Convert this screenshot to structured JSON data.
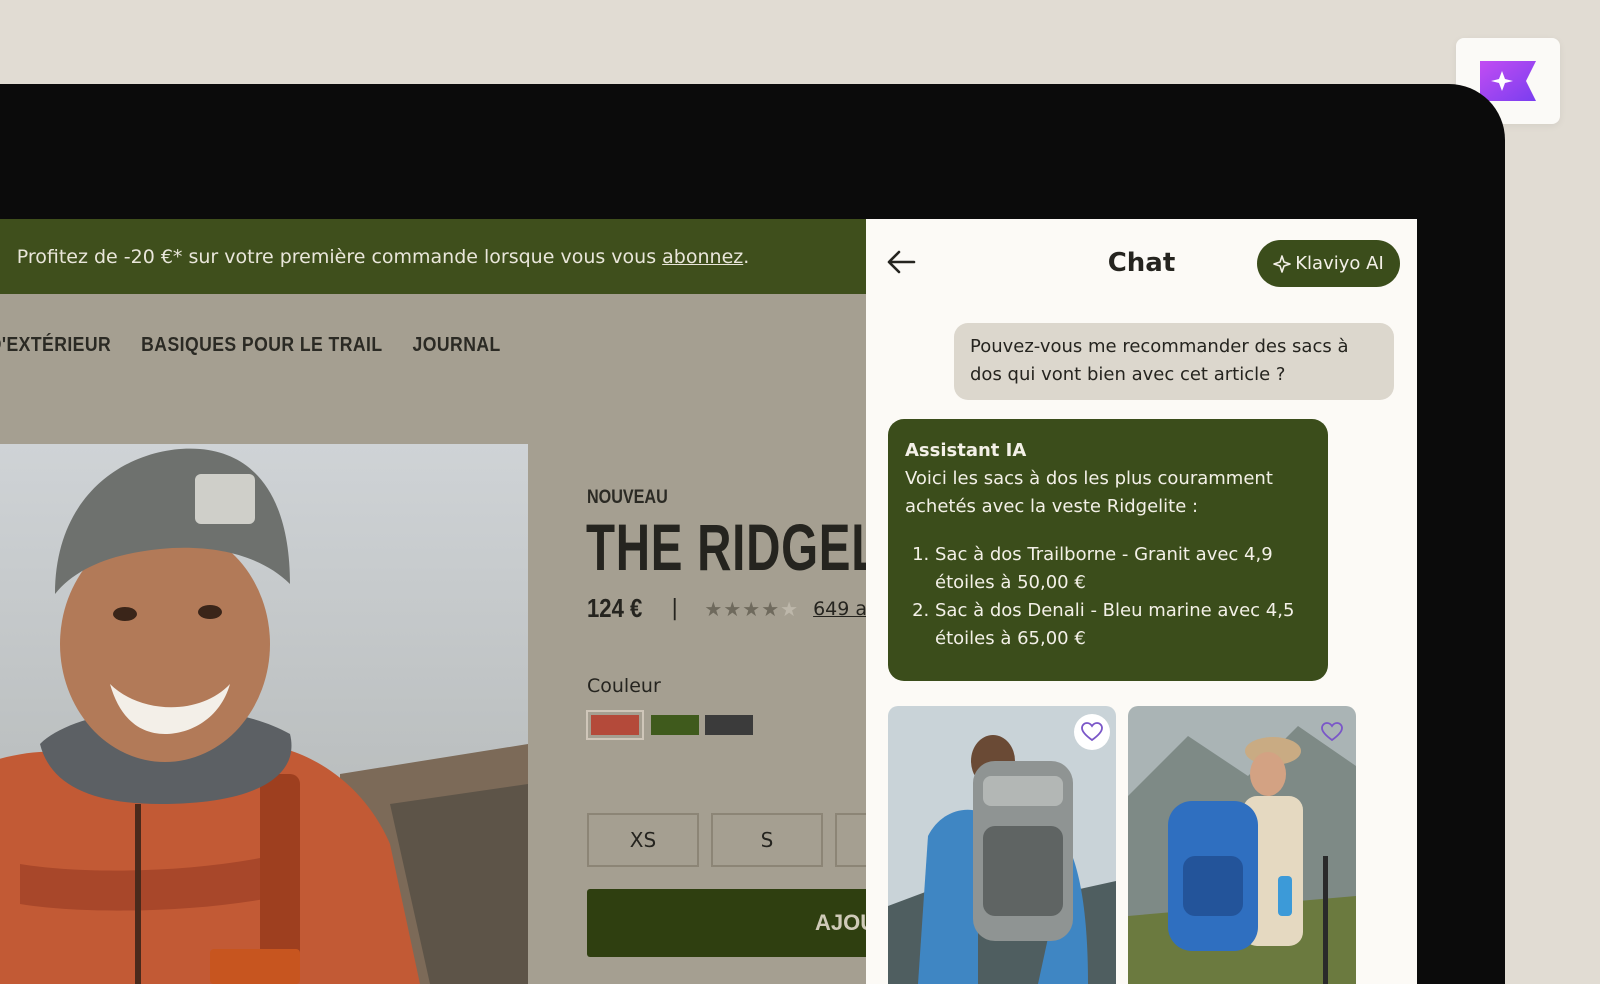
{
  "promo": {
    "text": "Profitez de -20 €* sur votre première commande lorsque vous vous ",
    "link": "abonnez",
    "suffix": "."
  },
  "nav": {
    "items": [
      "TS D'EXTÉRIEUR",
      "BASIQUES POUR LE TRAIL",
      "JOURNAL"
    ]
  },
  "product": {
    "badge": "NOUVEAU",
    "title": "THE RIDGELITE",
    "price": "124 €",
    "separator": "|",
    "rating": 4,
    "rating_max": 5,
    "reviews": "649 a",
    "color_label": "Couleur",
    "colors": [
      "#b44a3a",
      "#3f5a1c",
      "#3b3b3b"
    ],
    "sizes": [
      "XS",
      "S"
    ],
    "add_label": "AJOUT"
  },
  "chat": {
    "title": "Chat",
    "ai_button": "Klaviyo AI",
    "user_message": "Pouvez-vous me recommander des sacs à dos qui vont bien avec cet article ?",
    "assistant": {
      "name": "Assistant IA",
      "intro": "Voici les sacs à dos les plus couramment achetés avec la veste Ridgelite :",
      "items": [
        "Sac à dos Trailborne - Granit avec 4,9 étoiles à 50,00 €",
        "Sac à dos Denali - Bleu marine avec 4,5 étoiles à 65,00 €"
      ]
    }
  },
  "colors": {
    "brand_green": "#3b4d1b",
    "promo_green": "#3f4f1c",
    "klaviyo_purple": "#a84bf0"
  }
}
